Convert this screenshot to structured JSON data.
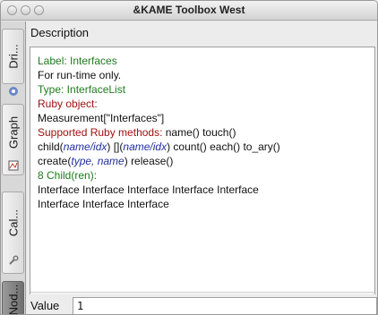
{
  "window": {
    "title": "&KAME Toolbox West"
  },
  "tabs": [
    {
      "label": "Dri...",
      "icon": "dot-circle-icon",
      "selected": false
    },
    {
      "label": "Graph",
      "icon": "graph-icon",
      "selected": false
    },
    {
      "label": "Cal...",
      "icon": "wrench-icon",
      "selected": false
    },
    {
      "label": "Nod...",
      "icon": "node-icon",
      "selected": true
    }
  ],
  "panel": {
    "header": "Description",
    "lines": [
      {
        "parts": [
          {
            "text": "Label: Interfaces",
            "cls": "green"
          }
        ]
      },
      {
        "parts": [
          {
            "text": "For run-time only.",
            "cls": ""
          }
        ]
      },
      {
        "parts": [
          {
            "text": "Type: InterfaceList",
            "cls": "green"
          }
        ]
      },
      {
        "parts": [
          {
            "text": "Ruby object:",
            "cls": "red"
          }
        ]
      },
      {
        "parts": [
          {
            "text": "Measurement[\"Interfaces\"]",
            "cls": ""
          }
        ]
      },
      {
        "parts": [
          {
            "text": "Supported Ruby methods:",
            "cls": "red"
          },
          {
            "text": " name() touch()",
            "cls": ""
          }
        ]
      },
      {
        "parts": [
          {
            "text": " child(",
            "cls": ""
          },
          {
            "text": "name/idx",
            "cls": "blue"
          },
          {
            "text": ") [](",
            "cls": ""
          },
          {
            "text": "name/idx",
            "cls": "blue"
          },
          {
            "text": ") count() each() to_ary()",
            "cls": ""
          }
        ]
      },
      {
        "parts": [
          {
            "text": " create(",
            "cls": ""
          },
          {
            "text": "type, name",
            "cls": "blue"
          },
          {
            "text": ") release()",
            "cls": ""
          }
        ]
      },
      {
        "parts": [
          {
            "text": " 8 Child(ren):",
            "cls": "green"
          }
        ]
      },
      {
        "parts": [
          {
            "text": "Interface Interface Interface Interface Interface",
            "cls": ""
          }
        ]
      },
      {
        "parts": [
          {
            "text": " Interface Interface Interface",
            "cls": ""
          }
        ]
      }
    ],
    "value_label": "Value",
    "value": "1"
  }
}
